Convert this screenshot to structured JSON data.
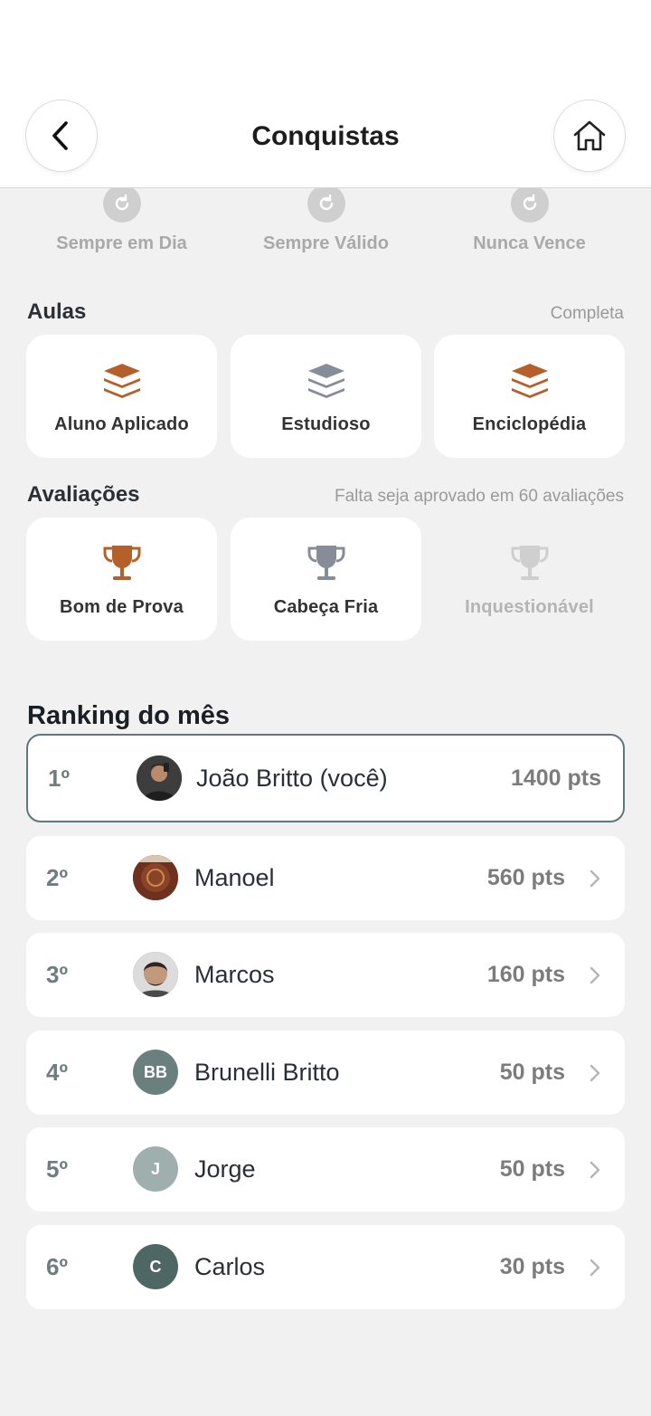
{
  "header": {
    "title": "Conquistas",
    "back_icon": "chevron-left-icon",
    "home_icon": "home-icon"
  },
  "top_row": [
    {
      "label": "Sempre em Dia",
      "icon": "refresh-icon"
    },
    {
      "label": "Sempre Válido",
      "icon": "refresh-icon"
    },
    {
      "label": "Nunca Vence",
      "icon": "refresh-icon"
    }
  ],
  "aulas": {
    "title": "Aulas",
    "note": "Completa",
    "cards": [
      {
        "label": "Aluno Aplicado",
        "icon": "layers-icon",
        "color": "#b5602b"
      },
      {
        "label": "Estudioso",
        "icon": "layers-icon",
        "color": "#878d98"
      },
      {
        "label": "Enciclopédia",
        "icon": "layers-icon",
        "color": "#b5602b"
      }
    ]
  },
  "avaliacoes": {
    "title": "Avaliações",
    "note": "Falta seja aprovado em 60 avaliações",
    "cards": [
      {
        "label": "Bom de Prova",
        "icon": "trophy-icon",
        "color": "#b5602b"
      },
      {
        "label": "Cabeça Fria",
        "icon": "trophy-icon",
        "color": "#878d98"
      },
      {
        "label": "Inquestionável",
        "icon": "trophy-icon",
        "color": "#cfcfcf"
      }
    ]
  },
  "ranking": {
    "title": "Ranking do mês",
    "rows": [
      {
        "position": "1º",
        "name": "João Britto (você)",
        "points": "1400 pts",
        "avatar": "photo",
        "avatar_color": "#3a3a3a"
      },
      {
        "position": "2º",
        "name": "Manoel",
        "points": "560 pts",
        "avatar": "photo",
        "avatar_color": "#7a3a22"
      },
      {
        "position": "3º",
        "name": "Marcos",
        "points": "160 pts",
        "avatar": "photo",
        "avatar_color": "#5b544e"
      },
      {
        "position": "4º",
        "name": "Brunelli Britto",
        "points": "50 pts",
        "avatar": "BB",
        "avatar_color": "#6a807e"
      },
      {
        "position": "5º",
        "name": "Jorge",
        "points": "50 pts",
        "avatar": "J",
        "avatar_color": "#9fafad"
      },
      {
        "position": "6º",
        "name": "Carlos",
        "points": "30 pts",
        "avatar": "C",
        "avatar_color": "#4e6664"
      }
    ]
  }
}
